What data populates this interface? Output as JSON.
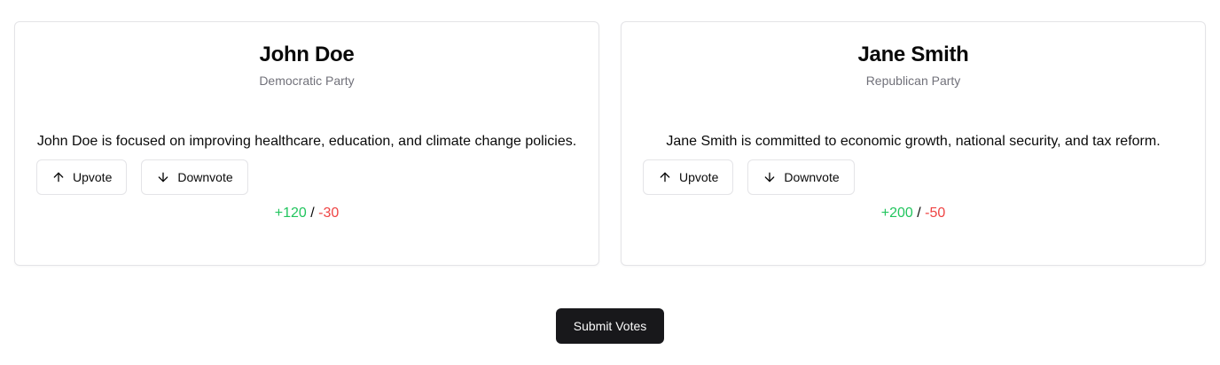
{
  "candidates": [
    {
      "name": "John Doe",
      "party": "Democratic Party",
      "description": "John Doe is focused on improving healthcare, education, and climate change policies.",
      "upvote_label": "Upvote",
      "downvote_label": "Downvote",
      "upvotes": "+120",
      "separator": "/",
      "downvotes": "-30"
    },
    {
      "name": "Jane Smith",
      "party": "Republican Party",
      "description": "Jane Smith is committed to economic growth, national security, and tax reform.",
      "upvote_label": "Upvote",
      "downvote_label": "Downvote",
      "upvotes": "+200",
      "separator": "/",
      "downvotes": "-50"
    }
  ],
  "submit_label": "Submit Votes",
  "colors": {
    "upvote": "#22c55e",
    "downvote": "#ef4444",
    "primary_button": "#18181b"
  },
  "icons": {
    "upvote": "arrow-up-icon",
    "downvote": "arrow-down-icon"
  }
}
